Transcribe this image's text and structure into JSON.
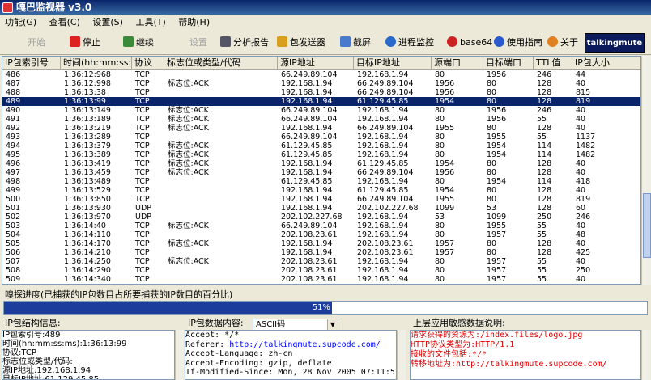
{
  "title": "嘎巴监视器 v3.0",
  "menu": [
    "功能(G)",
    "查看(C)",
    "设置(S)",
    "工具(T)",
    "帮助(H)"
  ],
  "toolbar": {
    "start": "开始",
    "stop": "停止",
    "continue": "继续",
    "settings": "设置",
    "report": "分析报告",
    "sender": "包发送器",
    "screenshot": "截屏",
    "process": "进程监控",
    "base64": "base64",
    "guide": "使用指南",
    "about": "关于",
    "brand": "talkingmute"
  },
  "columns": [
    "IP包索引号",
    "时间(hh:mm:ss:ms)",
    "协议",
    "标志位或类型/代码",
    "源IP地址",
    "目标IP地址",
    "源端口",
    "目标端口",
    "TTL值",
    "IP包大小"
  ],
  "rows": [
    [
      "486",
      "1:36:12:968",
      "TCP",
      "",
      "66.249.89.104",
      "192.168.1.94",
      "80",
      "1956",
      "246",
      "44"
    ],
    [
      "487",
      "1:36:12:998",
      "TCP",
      "标志位:ACK",
      "192.168.1.94",
      "66.249.89.104",
      "1956",
      "80",
      "128",
      "40"
    ],
    [
      "488",
      "1:36:13:38",
      "TCP",
      "",
      "192.168.1.94",
      "66.249.89.104",
      "1956",
      "80",
      "128",
      "815"
    ],
    [
      "489",
      "1:36:13:99",
      "TCP",
      "",
      "192.168.1.94",
      "61.129.45.85",
      "1954",
      "80",
      "128",
      "819"
    ],
    [
      "490",
      "1:36:13:149",
      "TCP",
      "标志位:ACK",
      "66.249.89.104",
      "192.168.1.94",
      "80",
      "1956",
      "246",
      "40"
    ],
    [
      "491",
      "1:36:13:189",
      "TCP",
      "标志位:ACK",
      "66.249.89.104",
      "192.168.1.94",
      "80",
      "1956",
      "55",
      "40"
    ],
    [
      "492",
      "1:36:13:219",
      "TCP",
      "标志位:ACK",
      "192.168.1.94",
      "66.249.89.104",
      "1955",
      "80",
      "128",
      "40"
    ],
    [
      "493",
      "1:36:13:289",
      "TCP",
      "",
      "66.249.89.104",
      "192.168.1.94",
      "80",
      "1955",
      "55",
      "1137"
    ],
    [
      "494",
      "1:36:13:379",
      "TCP",
      "标志位:ACK",
      "61.129.45.85",
      "192.168.1.94",
      "80",
      "1954",
      "114",
      "1482"
    ],
    [
      "495",
      "1:36:13:389",
      "TCP",
      "标志位:ACK",
      "61.129.45.85",
      "192.168.1.94",
      "80",
      "1954",
      "114",
      "1482"
    ],
    [
      "496",
      "1:36:13:419",
      "TCP",
      "标志位:ACK",
      "192.168.1.94",
      "61.129.45.85",
      "1954",
      "80",
      "128",
      "40"
    ],
    [
      "497",
      "1:36:13:459",
      "TCP",
      "标志位:ACK",
      "192.168.1.94",
      "66.249.89.104",
      "1956",
      "80",
      "128",
      "40"
    ],
    [
      "498",
      "1:36:13:489",
      "TCP",
      "",
      "61.129.45.85",
      "192.168.1.94",
      "80",
      "1954",
      "114",
      "418"
    ],
    [
      "499",
      "1:36:13:529",
      "TCP",
      "",
      "192.168.1.94",
      "61.129.45.85",
      "1954",
      "80",
      "128",
      "40"
    ],
    [
      "500",
      "1:36:13:850",
      "TCP",
      "",
      "192.168.1.94",
      "66.249.89.104",
      "1955",
      "80",
      "128",
      "819"
    ],
    [
      "501",
      "1:36:13:930",
      "UDP",
      "",
      "192.168.1.94",
      "202.102.227.68",
      "1099",
      "53",
      "128",
      "60"
    ],
    [
      "502",
      "1:36:13:970",
      "UDP",
      "",
      "202.102.227.68",
      "192.168.1.94",
      "53",
      "1099",
      "250",
      "246"
    ],
    [
      "503",
      "1:36:14:40",
      "TCP",
      "标志位:ACK",
      "66.249.89.104",
      "192.168.1.94",
      "80",
      "1955",
      "55",
      "40"
    ],
    [
      "504",
      "1:36:14:110",
      "TCP",
      "",
      "202.108.23.61",
      "192.168.1.94",
      "80",
      "1957",
      "55",
      "48"
    ],
    [
      "505",
      "1:36:14:170",
      "TCP",
      "标志位:ACK",
      "192.168.1.94",
      "202.108.23.61",
      "1957",
      "80",
      "128",
      "40"
    ],
    [
      "506",
      "1:36:14:210",
      "TCP",
      "",
      "192.168.1.94",
      "202.108.23.61",
      "1957",
      "80",
      "128",
      "425"
    ],
    [
      "507",
      "1:36:14:250",
      "TCP",
      "标志位:ACK",
      "202.108.23.61",
      "192.168.1.94",
      "80",
      "1957",
      "55",
      "40"
    ],
    [
      "508",
      "1:36:14:290",
      "TCP",
      "",
      "202.108.23.61",
      "192.168.1.94",
      "80",
      "1957",
      "55",
      "250"
    ],
    [
      "509",
      "1:36:14:340",
      "TCP",
      "",
      "202.108.23.61",
      "192.168.1.94",
      "80",
      "1957",
      "55",
      "40"
    ]
  ],
  "selected_row": 3,
  "progress": {
    "label": "嗅探进度(已捕获的IP包数目占所要捕获的IP数目的百分比)",
    "percent": 51,
    "text": "51%"
  },
  "struct_pane": {
    "title": "IP包结构信息:",
    "lines": [
      "IP包索引号:489",
      "时间(hh:mm:ss:ms):1:36:13:99",
      "协议:TCP",
      "标志位或类型/代码:",
      "源IP地址:192.168.1.94",
      "目标IP地址:61.129.45.85"
    ]
  },
  "data_pane": {
    "title": "IP包数据内容:",
    "encoding": "ASCII码",
    "lines": [
      "Accept: */*",
      "Referer: ",
      "Accept-Language: zh-cn",
      "Accept-Encoding: gzip, deflate",
      "If-Modified-Since: Mon, 28 Nov 2005 07:11:57"
    ],
    "referer_link": "http://talkingmute.supcode.com/"
  },
  "sensitive_pane": {
    "title": "上层应用敏感数据说明:",
    "lines": [
      "请求获得的资源为:/index.files/logo.jpg",
      "HTTP协议类型为:HTTP/1.1",
      "接收的文件包括:*/*",
      "转移地址为:http://talkingmute.supcode.com/"
    ]
  },
  "colors": {
    "selection": "#0a246a",
    "progress_fill": "#1c3d9c",
    "sensitive_text": "#e00000",
    "link": "#0000ff"
  }
}
